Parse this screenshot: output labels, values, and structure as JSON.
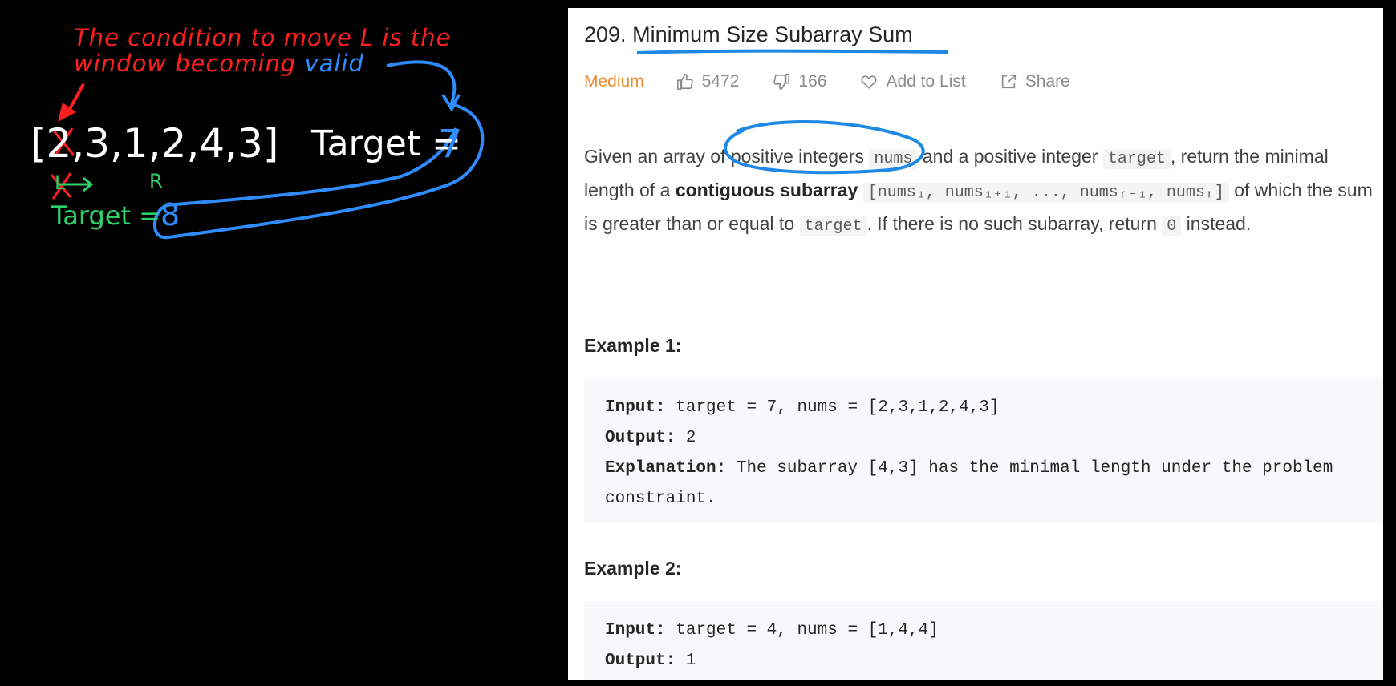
{
  "annotations": {
    "note_line1": "The condition to move L is the",
    "note_line2_a": "window becoming",
    "note_line2_b": "valid",
    "array_open": "[",
    "array_first": "2",
    "array_rest": ",3,1,2,4,3]",
    "target_label": "Target =",
    "target_value": "7",
    "pointer_l": "L",
    "pointer_r": "R",
    "running_label": "Target =",
    "running_value": "8",
    "colors": {
      "red": "#ff1f1f",
      "blue": "#2f8cff",
      "green": "#2fd26a",
      "white": "#ffffff"
    }
  },
  "problem": {
    "number": "209.",
    "title": "Minimum Size Subarray Sum",
    "difficulty": "Medium",
    "likes": "5472",
    "dislikes": "166",
    "add_to_list": "Add to List",
    "share": "Share",
    "icons": [
      "thumbs-up-icon",
      "thumbs-down-icon",
      "heart-icon",
      "share-icon"
    ],
    "desc": {
      "p1": "Given an array of",
      "positive_integers": "positive integers",
      "nums": "nums",
      "p2": "and a positive integer",
      "target": "target",
      "p3": ", return the minimal length of a",
      "contiguous": "contiguous subarray",
      "range": "[nums₁, nums₁₊₁, ..., numsᵣ₋₁, numsᵣ]",
      "p4": "of which the sum is greater than or equal to",
      "target2": "target",
      "p5": ". If there is no such subarray, return",
      "zero": "0",
      "p6": "instead."
    },
    "examples": [
      {
        "title": "Example 1:",
        "input_key": "Input:",
        "input_val": "target = 7, nums = [2,3,1,2,4,3]",
        "output_key": "Output:",
        "output_val": "2",
        "expl_key": "Explanation:",
        "expl_val": "The subarray [4,3] has the minimal length under the problem constraint."
      },
      {
        "title": "Example 2:",
        "input_key": "Input:",
        "input_val": "target = 4, nums = [1,4,4]",
        "output_key": "Output:",
        "output_val": "1"
      }
    ]
  }
}
